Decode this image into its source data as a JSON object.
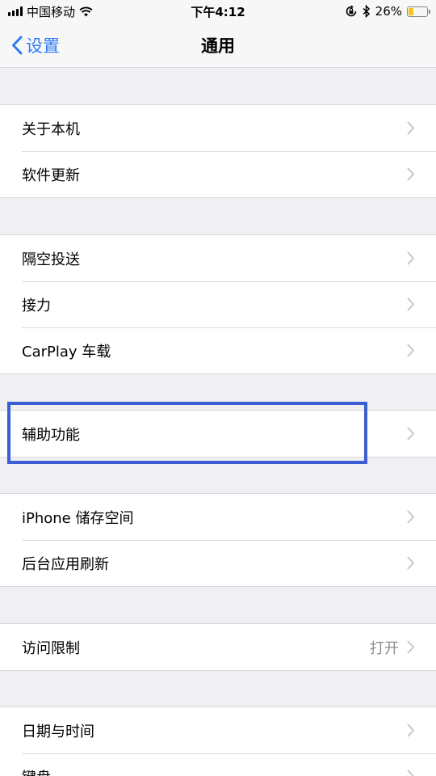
{
  "status_bar": {
    "carrier": "中国移动",
    "time": "下午4:12",
    "battery_percent": "26%",
    "battery_level": 0.26,
    "icons": [
      "signal-icon",
      "wifi-icon",
      "rotation-lock-icon",
      "bluetooth-icon",
      "battery-icon"
    ]
  },
  "nav": {
    "back_label": "设置",
    "title": "通用"
  },
  "groups": [
    {
      "items": [
        {
          "label": "关于本机"
        },
        {
          "label": "软件更新"
        }
      ]
    },
    {
      "items": [
        {
          "label": "隔空投送"
        },
        {
          "label": "接力"
        },
        {
          "label": "CarPlay 车载"
        }
      ]
    },
    {
      "items": [
        {
          "label": "辅助功能"
        }
      ]
    },
    {
      "items": [
        {
          "label": "iPhone 储存空间"
        },
        {
          "label": "后台应用刷新"
        }
      ]
    },
    {
      "items": [
        {
          "label": "访问限制",
          "value": "打开"
        }
      ]
    },
    {
      "items": [
        {
          "label": "日期与时间"
        },
        {
          "label": "键盘"
        }
      ]
    }
  ],
  "colors": {
    "accent": "#2f7cf6",
    "highlight": "#3b5fd3",
    "background": "#efeff4",
    "battery": "#f5c518"
  }
}
